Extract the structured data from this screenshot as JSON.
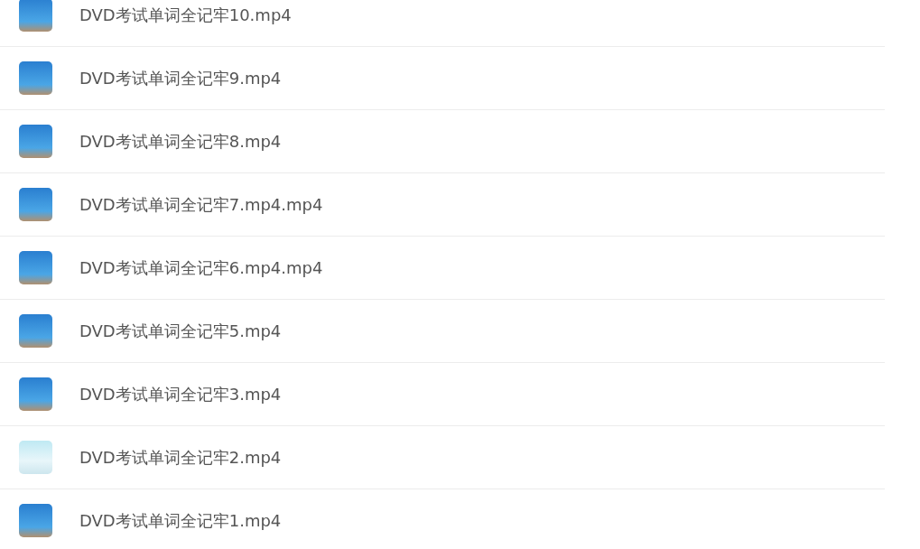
{
  "files": [
    {
      "name": "DVD考试单词全记牢10.mp4",
      "kind": "cartoon"
    },
    {
      "name": "DVD考试单词全记牢9.mp4",
      "kind": "cartoon"
    },
    {
      "name": "DVD考试单词全记牢8.mp4",
      "kind": "cartoon"
    },
    {
      "name": "DVD考试单词全记牢7.mp4.mp4",
      "kind": "cartoon"
    },
    {
      "name": "DVD考试单词全记牢6.mp4.mp4",
      "kind": "cartoon"
    },
    {
      "name": "DVD考试单词全记牢5.mp4",
      "kind": "cartoon"
    },
    {
      "name": "DVD考试单词全记牢3.mp4",
      "kind": "cartoon"
    },
    {
      "name": "DVD考试单词全记牢2.mp4",
      "kind": "photo"
    },
    {
      "name": "DVD考试单词全记牢1.mp4",
      "kind": "cartoon"
    }
  ]
}
